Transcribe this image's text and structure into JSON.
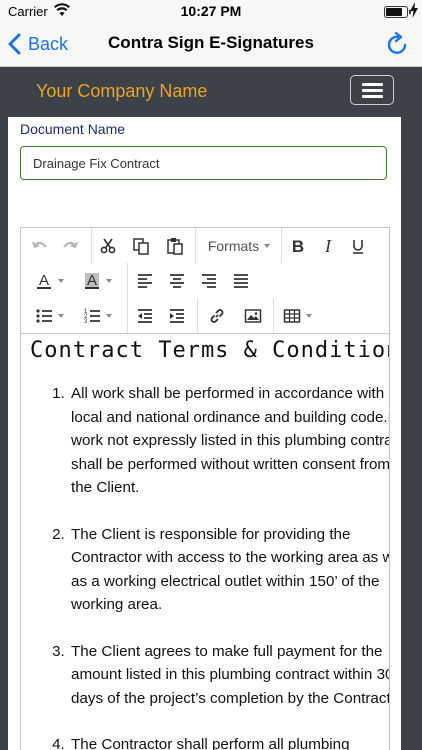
{
  "status_bar": {
    "carrier": "Carrier",
    "time": "10:27 PM",
    "battery_level": 0.9
  },
  "nav": {
    "back_label": "Back",
    "title": "Contra Sign E-Signatures"
  },
  "header": {
    "company_name": "Your Company Name"
  },
  "form": {
    "document_label": "Document Name",
    "document_value": "Drainage Fix Contract"
  },
  "editor": {
    "formats_label": "Formats",
    "heading": "Contract Terms & Conditions",
    "terms": [
      "All work shall be performed in accordance with local and national ordinance and building code.No work not expressly listed in this plumbing contract shall be performed without written consent from the Client.",
      "The Client is responsible for providing the Contractor with access to the working area as well as a working electrical outlet within 150’ of the working area.",
      "The Client agrees to make full payment for the amount listed in this plumbing contract within 30 days of the project’s completion by the Contractor.",
      "The Contractor shall perform all plumbing"
    ]
  },
  "colors": {
    "accent": "#1a73e8",
    "header_bg": "#3c4248",
    "company_name": "#e8a624",
    "input_border": "#3e7a2c",
    "label": "#1e2a6e"
  },
  "icons": {
    "toolbar": [
      "undo-icon",
      "redo-icon",
      "cut-icon",
      "copy-icon",
      "paste-icon",
      "bold-icon",
      "italic-icon",
      "underline-icon",
      "text-color-icon",
      "background-color-icon",
      "align-left-icon",
      "align-center-icon",
      "align-right-icon",
      "align-justify-icon",
      "bullet-list-icon",
      "numbered-list-icon",
      "outdent-icon",
      "indent-icon",
      "link-icon",
      "image-icon",
      "table-icon"
    ]
  }
}
